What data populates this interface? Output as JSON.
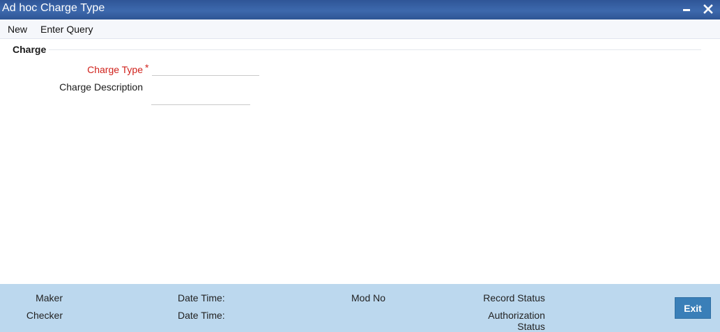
{
  "window": {
    "title": "Ad hoc Charge Type",
    "controls": {
      "minimize_icon": "minimize-icon",
      "close_icon": "close-icon"
    }
  },
  "toolbar": {
    "new_label": "New",
    "enter_query_label": "Enter Query"
  },
  "section": {
    "title": "Charge"
  },
  "form": {
    "charge_type_label": "Charge Type",
    "required_mark": "*",
    "charge_type_value": "",
    "charge_description_label": "Charge Description",
    "charge_description_value": ""
  },
  "footer": {
    "maker_label": "Maker",
    "maker_datetime_label": "Date Time:",
    "checker_label": "Checker",
    "checker_datetime_label": "Date Time:",
    "mod_no_label": "Mod No",
    "record_status_label": "Record Status",
    "authorization_status_line1": "Authorization",
    "authorization_status_line2": "Status",
    "exit_label": "Exit"
  },
  "colors": {
    "titlebar": "#3d69ad",
    "required": "#d0211b",
    "footer_bg": "#bcd8ee",
    "exit_button": "#3a7fb8"
  }
}
